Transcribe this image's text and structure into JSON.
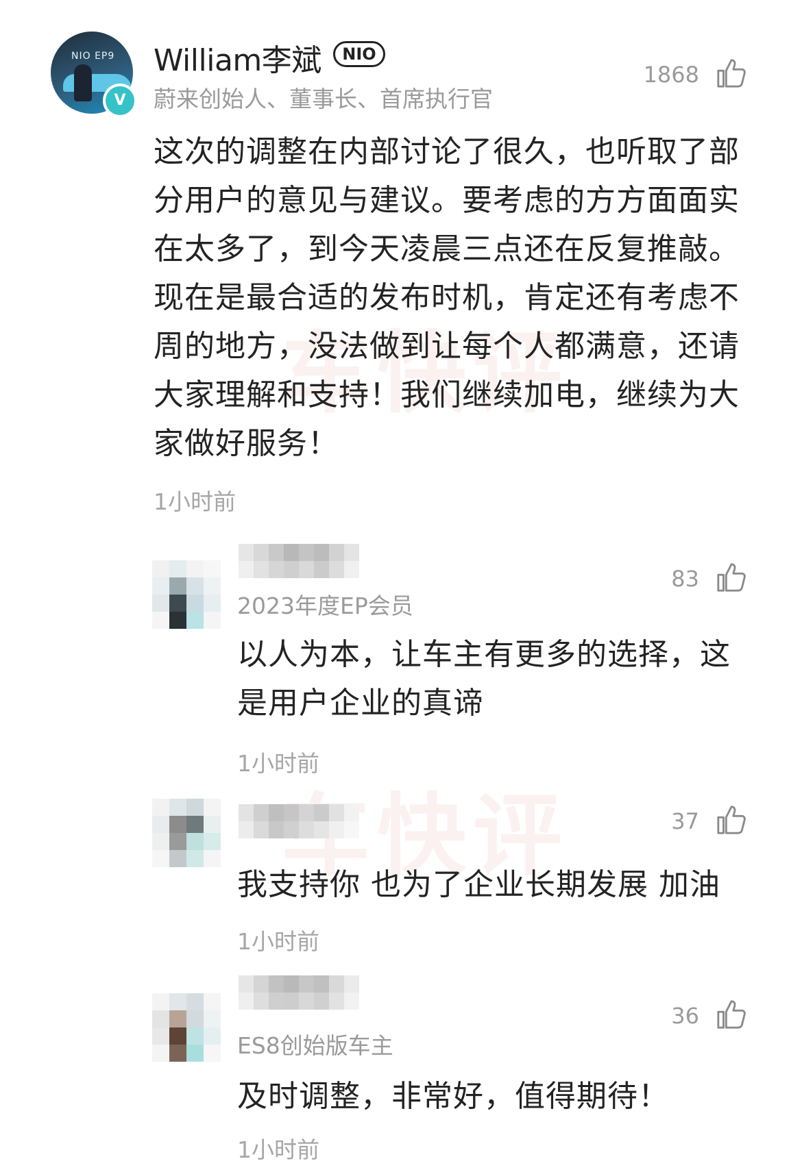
{
  "main_comment": {
    "author": "William李斌",
    "badge": "NIO",
    "avatar_brand": "NIO EP9",
    "verified_mark": "V",
    "author_title": "蔚来创始人、董事长、首席执行官",
    "likes": "1868",
    "text": "这次的调整在内部讨论了很久，也听取了部分用户的意见与建议。要考虑的方方面面实在太多了，到今天凌晨三点还在反复推敲。现在是最合适的发布时机，肯定还有考虑不周的地方，没法做到让每个人都满意，还请大家理解和支持！我们继续加电，继续为大家做好服务！",
    "time": "1小时前"
  },
  "watermark": "车快评",
  "replies": [
    {
      "subtitle": "2023年度EP会员",
      "likes": "83",
      "text": "以人为本，让车主有更多的选择，这是用户企业的真谛",
      "time": "1小时前"
    },
    {
      "subtitle": "",
      "likes": "37",
      "text": "我支持你 也为了企业长期发展 加油",
      "time": "1小时前"
    },
    {
      "subtitle": "ES8创始版车主",
      "likes": "36",
      "text": "及时调整，非常好，值得期待！",
      "time": "1小时前"
    }
  ],
  "icons": {
    "like": "thumbs-up-icon",
    "verified": "verified-badge-icon"
  },
  "colors": {
    "verified_badge": "#35c3c8",
    "secondary_text": "#9a9a9a",
    "primary_text": "#232323"
  }
}
